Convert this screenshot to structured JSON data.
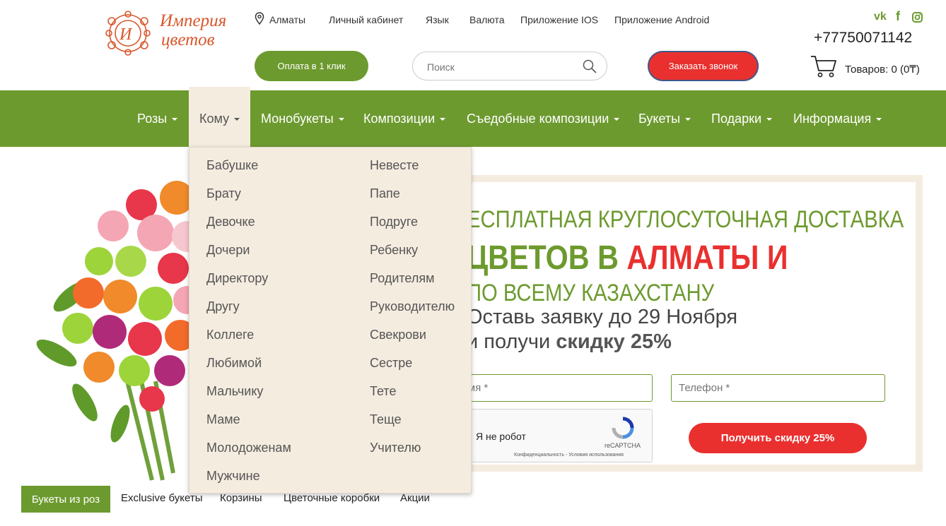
{
  "header": {
    "logo_line1": "Империя",
    "logo_line2": "цветов",
    "city": "Алматы",
    "links": [
      "Личный кабинет",
      "Язык",
      "Валюта",
      "Приложение IOS",
      "Приложение Android"
    ],
    "social": [
      "vk-icon",
      "facebook-icon",
      "instagram-icon"
    ],
    "phone": "+77750071142",
    "pay_button": "Оплата в 1 клик",
    "search_placeholder": "Поиск",
    "callback_button": "Заказать звонок",
    "cart_text": "Товаров: 0 (0₸)"
  },
  "nav": {
    "items": [
      "Розы",
      "Кому",
      "Монобукеты",
      "Композиции",
      "Съедобные композиции",
      "Букеты",
      "Подарки",
      "Информация"
    ],
    "active_index": 1
  },
  "dropdown": {
    "col1": [
      "Бабушке",
      "Брату",
      "Девочке",
      "Дочери",
      "Директору",
      "Другу",
      "Коллеге",
      "Любимой",
      "Мальчику",
      "Маме",
      "Молодоженам",
      "Мужчине"
    ],
    "col2": [
      "Невесте",
      "Папе",
      "Подруге",
      "Ребенку",
      "Родителям",
      "Руководителю",
      "Свекрови",
      "Сестре",
      "Тете",
      "Теще",
      "Учителю"
    ]
  },
  "banner": {
    "line1": "ЕСПЛАТНАЯ КРУГЛОСУТОЧНАЯ ДОСТАВКА",
    "line2_green": "ЦВЕТОВ В ",
    "line2_red": "АЛМАТЫ И",
    "line3": "ПО ВСЕМУ КАЗАХСТАНУ",
    "line4": "Оставь заявку до 29 Ноября",
    "line5_prefix": "и получи ",
    "line5_bold": "скидку 25%",
    "name_placeholder": "Имя *",
    "phone_placeholder": "Телефон *",
    "captcha_label": "Я не робот",
    "captcha_brand": "reCAPTCHA",
    "captcha_terms": "Конфиденциальность - Условия использования",
    "submit": "Получить скидку 25%"
  },
  "tabs": {
    "items": [
      "Букеты из роз",
      "Exclusive букеты",
      "Корзины",
      "Цветочные коробки",
      "Акции"
    ],
    "active_index": 0
  },
  "colors": {
    "green": "#6d9a2f",
    "red": "#e9302f",
    "beige": "#f5ece0",
    "logo": "#d9572b"
  }
}
